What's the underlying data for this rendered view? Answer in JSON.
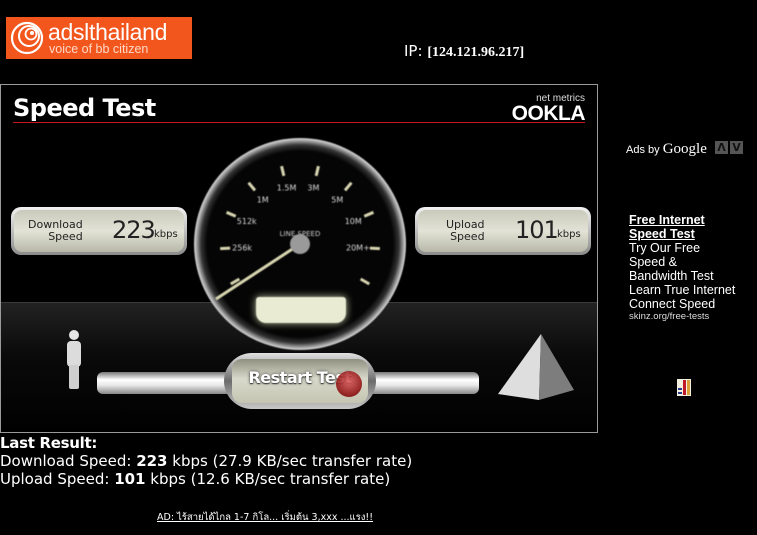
{
  "logo": {
    "name": "adslthailand",
    "tagline": "voice of bb citizen",
    "brand_color": "#f2561d"
  },
  "ip": {
    "label": "IP:",
    "value": "[124.121.96.217]"
  },
  "speed_test": {
    "title": "Speed Test",
    "vendor_small": "net metrics",
    "vendor": "OOKLA",
    "accent_color": "#c4161c",
    "gauge": {
      "label": "LINE SPEED",
      "ticks": [
        "256k",
        "512k",
        "1M",
        "1.5M",
        "3M",
        "5M",
        "10M",
        "20M+"
      ]
    },
    "download": {
      "label_line1": "Download",
      "label_line2": "Speed",
      "value": "223",
      "unit": "kbps"
    },
    "upload": {
      "label_line1": "Upload",
      "label_line2": "Speed",
      "value": "101",
      "unit": "kbps"
    },
    "restart_label": "Restart Test"
  },
  "ads": {
    "ads_by": "Ads by",
    "google": "Google",
    "prev": "Λ",
    "next": "V",
    "headline_1": "Free Internet",
    "headline_2": "Speed Test",
    "body": [
      "Try Our Free",
      "Speed &",
      "Bandwidth Test",
      "Learn True Internet",
      "Connect Speed"
    ],
    "url": "skinz.org/free-tests"
  },
  "last_result": {
    "heading": "Last Result:",
    "download_label": "Download Speed:",
    "download_value": "223",
    "download_rest": "kbps (27.9 KB/sec transfer rate)",
    "upload_label": "Upload Speed:",
    "upload_value": "101",
    "upload_rest": "kbps (12.6 KB/sec transfer rate)"
  },
  "footer_ad": "AD: ไร้สายได้ไกล 1-7 กิโล... เริ่มต้น 3,xxx ...แรง!!"
}
